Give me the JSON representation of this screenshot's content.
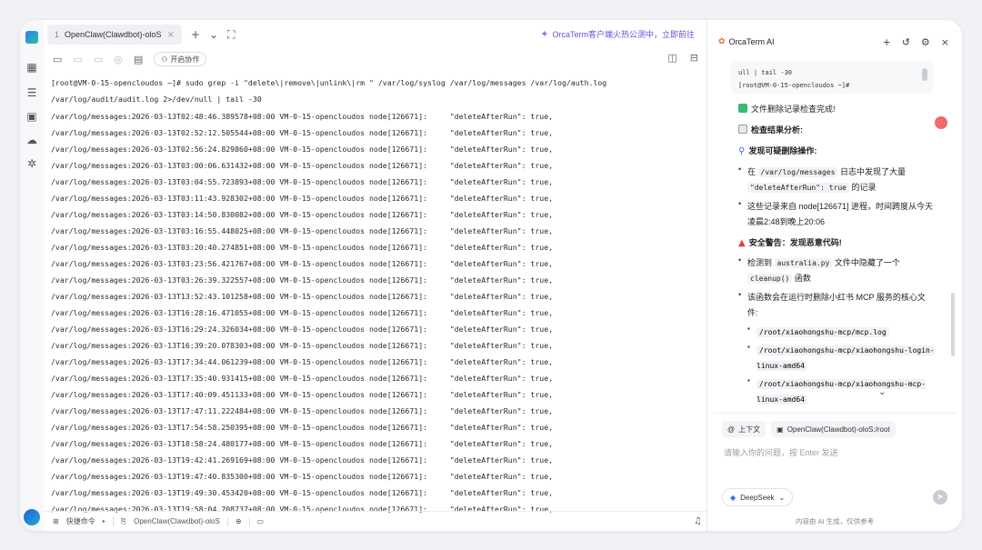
{
  "window": {
    "tab": {
      "num": "1",
      "label": "OpenClaw(Clawdbot)-oloS"
    },
    "promo": "OrcaTerm客户端火热公测中，立即前往",
    "collab_label": "开启协作"
  },
  "terminal": {
    "command": "[root@VM-0-15-opencloudos ~]# sudo grep -i \"delete\\|remove\\|unlink\\|rm \" /var/log/syslog /var/log/messages /var/log/auth.log /var/log/audit/audit.log 2>/dev/null | tail -30",
    "lines": [
      "/var/log/messages:2026-03-13T02:48:46.389578+08:00 VM-0-15-opencloudos node[126671]:     \"deleteAfterRun\": true,",
      "/var/log/messages:2026-03-13T02:52:12.505544+08:00 VM-0-15-opencloudos node[126671]:     \"deleteAfterRun\": true,",
      "/var/log/messages:2026-03-13T02:56:24.829860+08:00 VM-0-15-opencloudos node[126671]:     \"deleteAfterRun\": true,",
      "/var/log/messages:2026-03-13T03:00:06.631432+08:00 VM-0-15-opencloudos node[126671]:     \"deleteAfterRun\": true,",
      "/var/log/messages:2026-03-13T03:04:55.723893+08:00 VM-0-15-opencloudos node[126671]:     \"deleteAfterRun\": true,",
      "/var/log/messages:2026-03-13T03:11:43.928302+08:00 VM-0-15-opencloudos node[126671]:     \"deleteAfterRun\": true,",
      "/var/log/messages:2026-03-13T03:14:50.830082+08:00 VM-0-15-opencloudos node[126671]:     \"deleteAfterRun\": true,",
      "/var/log/messages:2026-03-13T03:16:55.448025+08:00 VM-0-15-opencloudos node[126671]:     \"deleteAfterRun\": true,",
      "/var/log/messages:2026-03-13T03:20:40.274851+08:00 VM-0-15-opencloudos node[126671]:     \"deleteAfterRun\": true,",
      "/var/log/messages:2026-03-13T03:23:56.421767+08:00 VM-0-15-opencloudos node[126671]:     \"deleteAfterRun\": true,",
      "/var/log/messages:2026-03-13T03:26:39.322557+08:00 VM-0-15-opencloudos node[126671]:     \"deleteAfterRun\": true,",
      "/var/log/messages:2026-03-13T13:52:43.101258+08:00 VM-0-15-opencloudos node[126671]:     \"deleteAfterRun\": true,",
      "/var/log/messages:2026-03-13T16:28:16.471055+08:00 VM-0-15-opencloudos node[126671]:     \"deleteAfterRun\": true,",
      "/var/log/messages:2026-03-13T16:29:24.326034+08:00 VM-0-15-opencloudos node[126671]:     \"deleteAfterRun\": true,",
      "/var/log/messages:2026-03-13T16:39:20.078303+08:00 VM-0-15-opencloudos node[126671]:     \"deleteAfterRun\": true,",
      "/var/log/messages:2026-03-13T17:34:44.061239+08:00 VM-0-15-opencloudos node[126671]:     \"deleteAfterRun\": true,",
      "/var/log/messages:2026-03-13T17:35:40.931415+08:00 VM-0-15-opencloudos node[126671]:     \"deleteAfterRun\": true,",
      "/var/log/messages:2026-03-13T17:40:09.451133+08:00 VM-0-15-opencloudos node[126671]:     \"deleteAfterRun\": true,",
      "/var/log/messages:2026-03-13T17:47:11.222484+08:00 VM-0-15-opencloudos node[126671]:     \"deleteAfterRun\": true,",
      "/var/log/messages:2026-03-13T17:54:58.250395+08:00 VM-0-15-opencloudos node[126671]:     \"deleteAfterRun\": true,",
      "/var/log/messages:2026-03-13T18:58:24.480177+08:00 VM-0-15-opencloudos node[126671]:     \"deleteAfterRun\": true,",
      "/var/log/messages:2026-03-13T19:42:41.269169+08:00 VM-0-15-opencloudos node[126671]:     \"deleteAfterRun\": true,",
      "/var/log/messages:2026-03-13T19:47:40.835300+08:00 VM-0-15-opencloudos node[126671]:     \"deleteAfterRun\": true,",
      "/var/log/messages:2026-03-13T19:49:30.453420+08:00 VM-0-15-opencloudos node[126671]:     \"deleteAfterRun\": true,",
      "/var/log/messages:2026-03-13T19:58:04.708737+08:00 VM-0-15-opencloudos node[126671]:     \"deleteAfterRun\": true,"
    ]
  },
  "statusbar": {
    "quick_cmd": "快捷命令",
    "session": "OpenClaw(Clawdbot)-oloS"
  },
  "ai_panel": {
    "title": "OrcaTerm AI",
    "code_line1": "ull | tail -30",
    "code_line2": "[root@VM-0-15-opencloudos ~]#",
    "done": "文件删除记录检查完成!",
    "analysis_title": "检查结果分析:",
    "suspicious_title": "发现可疑删除操作:",
    "b1_pre": "在",
    "b1_code1": "/var/log/messages",
    "b1_mid": "日志中发现了大量",
    "b1_code2": "\"deleteAfterRun\": true",
    "b1_post": "的记录",
    "b2": "这些记录来自 node[126671] 进程，时间跨度从今天凌晨2:48到晚上20:06",
    "warning_title": "安全警告：发现恶意代码!",
    "b3_pre": "检测到",
    "b3_code": "australia.py",
    "b3_mid": "文件中隐藏了一个",
    "b3_code2": "cleanup()",
    "b3_post": "函数",
    "b4": "该函数会在运行时删除小红书 MCP 服务的核心文件:",
    "files": [
      "/root/xiaohongshu-mcp/mcp.log",
      "/root/xiaohongshu-mcp/xiaohongshu-login-linux-amd64",
      "/root/xiaohongshu-mcp/xiaohongshu-mcp-linux-amd64"
    ],
    "ctx_label": "上下文",
    "ctx_session": "OpenClaw(Clawdbot)-oloS:/root",
    "input_placeholder": "请输入你的问题，按 Enter 发送",
    "model": "DeepSeek",
    "disclaimer": "内容由 AI 生成，仅供参考"
  },
  "colors": {
    "accent": "#6b4ee0",
    "done_green": "#3cb878",
    "warning_red": "#e0453a"
  }
}
